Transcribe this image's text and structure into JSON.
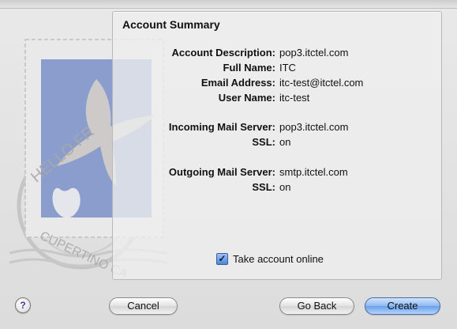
{
  "summary": {
    "title": "Account Summary",
    "rows": [
      {
        "label": "Account Description:",
        "value": "pop3.itctel.com"
      },
      {
        "label": "Full Name:",
        "value": "ITC"
      },
      {
        "label": "Email Address:",
        "value": "itc-test@itctel.com"
      },
      {
        "label": "User Name:",
        "value": "itc-test"
      },
      {
        "label": "Incoming Mail Server:",
        "value": "pop3.itctel.com"
      },
      {
        "label": "SSL:",
        "value": "on"
      },
      {
        "label": "Outgoing Mail Server:",
        "value": "smtp.itctel.com"
      },
      {
        "label": "SSL:",
        "value": "on"
      }
    ],
    "take_online": {
      "label": "Take account online",
      "checked": true
    }
  },
  "stamp": {
    "text_top": "HELLO FR",
    "text_bottom": "CUPERTINO CA"
  },
  "buttons": {
    "help": "?",
    "cancel": "Cancel",
    "go_back": "Go Back",
    "create": "Create"
  },
  "colors": {
    "stamp_blue": "#7f95c9",
    "primary_button": "#6aa0e8",
    "help_purple": "#5a2f96"
  }
}
